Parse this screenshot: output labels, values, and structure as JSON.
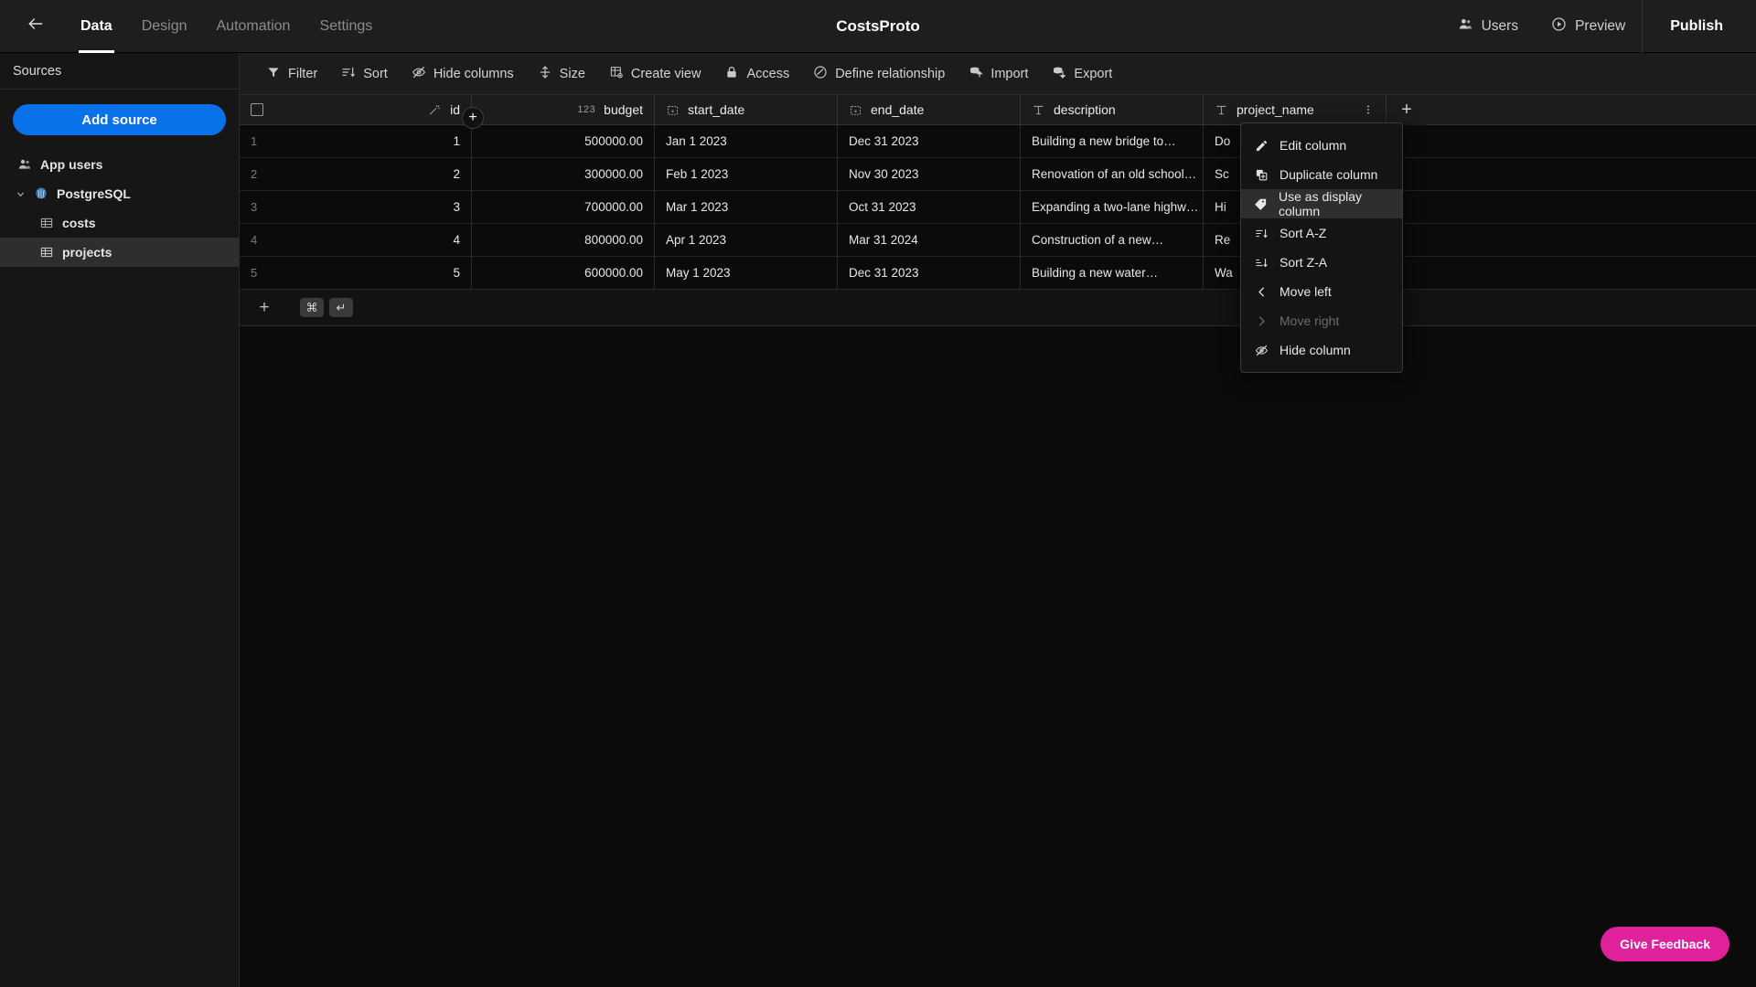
{
  "header": {
    "back_icon": "arrow-left-icon",
    "title": "CostsProto",
    "tabs": [
      {
        "label": "Data",
        "active": true
      },
      {
        "label": "Design",
        "active": false
      },
      {
        "label": "Automation",
        "active": false
      },
      {
        "label": "Settings",
        "active": false
      }
    ],
    "actions": [
      {
        "label": "Users",
        "icon": "users-icon"
      },
      {
        "label": "Preview",
        "icon": "play-circle-icon"
      }
    ],
    "publish": {
      "label": "Publish",
      "icon": "rocket-icon",
      "chevron": "chevron-down-icon"
    }
  },
  "sidebar": {
    "section_title": "Sources",
    "add_source_label": "Add source",
    "items": [
      {
        "label": "App users",
        "icon": "users-icon",
        "level": 0,
        "selected": false,
        "caret": false
      },
      {
        "label": "PostgreSQL",
        "icon": "postgres-icon",
        "level": 0,
        "selected": false,
        "caret": true,
        "expanded": true
      },
      {
        "label": "costs",
        "icon": "table-icon",
        "level": 2,
        "selected": false,
        "caret": false
      },
      {
        "label": "projects",
        "icon": "table-icon",
        "level": 2,
        "selected": true,
        "caret": false
      }
    ]
  },
  "toolbar": {
    "items": [
      {
        "label": "Filter",
        "icon": "filter-icon"
      },
      {
        "label": "Sort",
        "icon": "sort-icon"
      },
      {
        "label": "Hide columns",
        "icon": "eye-off-icon"
      },
      {
        "label": "Size",
        "icon": "row-height-icon"
      },
      {
        "label": "Create view",
        "icon": "create-view-icon"
      },
      {
        "label": "Access",
        "icon": "lock-icon"
      },
      {
        "label": "Define relationship",
        "icon": "relationship-icon"
      },
      {
        "label": "Import",
        "icon": "import-icon"
      },
      {
        "label": "Export",
        "icon": "export-icon"
      }
    ]
  },
  "grid": {
    "columns": [
      {
        "name": "id",
        "type_icon": "key-icon",
        "align": "right"
      },
      {
        "name": "budget",
        "type_icon": "number-123-icon",
        "align": "right"
      },
      {
        "name": "start_date",
        "type_icon": "calendar-icon",
        "align": "left"
      },
      {
        "name": "end_date",
        "type_icon": "calendar-icon",
        "align": "left"
      },
      {
        "name": "description",
        "type_icon": "text-icon",
        "align": "left"
      },
      {
        "name": "project_name",
        "type_icon": "text-icon",
        "align": "left",
        "menu_open": true
      }
    ],
    "add_column_label": "+",
    "rows": [
      {
        "num": "1",
        "id": "1",
        "budget": "500000.00",
        "start_date": "Jan 1 2023",
        "end_date": "Dec 31 2023",
        "description": "Building a new bridge to…",
        "project_name": "Do"
      },
      {
        "num": "2",
        "id": "2",
        "budget": "300000.00",
        "start_date": "Feb 1 2023",
        "end_date": "Nov 30 2023",
        "description": "Renovation of an old school…",
        "project_name": "Sc"
      },
      {
        "num": "3",
        "id": "3",
        "budget": "700000.00",
        "start_date": "Mar 1 2023",
        "end_date": "Oct 31 2023",
        "description": "Expanding a two-lane highw…",
        "project_name": "Hi"
      },
      {
        "num": "4",
        "id": "4",
        "budget": "800000.00",
        "start_date": "Apr 1 2023",
        "end_date": "Mar 31 2024",
        "description": "Construction of a new…",
        "project_name": "Re"
      },
      {
        "num": "5",
        "id": "5",
        "budget": "600000.00",
        "start_date": "May 1 2023",
        "end_date": "Dec 31 2023",
        "description": "Building a new water…",
        "project_name": "Wa"
      }
    ],
    "add_row": {
      "plus": "+",
      "kbd_cmd": "⌘",
      "kbd_enter": "↵"
    }
  },
  "column_menu": {
    "items": [
      {
        "label": "Edit column",
        "icon": "pencil-icon",
        "highlight": false,
        "disabled": false
      },
      {
        "label": "Duplicate column",
        "icon": "duplicate-icon",
        "highlight": false,
        "disabled": false
      },
      {
        "label": "Use as display column",
        "icon": "tag-icon",
        "highlight": true,
        "disabled": false
      },
      {
        "label": "Sort A-Z",
        "icon": "sort-asc-icon",
        "highlight": false,
        "disabled": false
      },
      {
        "label": "Sort Z-A",
        "icon": "sort-desc-icon",
        "highlight": false,
        "disabled": false
      },
      {
        "label": "Move left",
        "icon": "chevron-left-icon",
        "highlight": false,
        "disabled": false
      },
      {
        "label": "Move right",
        "icon": "chevron-right-icon",
        "highlight": false,
        "disabled": true
      },
      {
        "label": "Hide column",
        "icon": "eye-off-icon",
        "highlight": false,
        "disabled": false
      }
    ]
  },
  "feedback": {
    "label": "Give Feedback",
    "color": "#e0219c"
  },
  "colors": {
    "accent_blue": "#0a72e8",
    "pink": "#e0219c",
    "topbar_bg": "#1e1e1e",
    "sidebar_bg": "#161616",
    "grid_bg": "#0b0b0b"
  }
}
